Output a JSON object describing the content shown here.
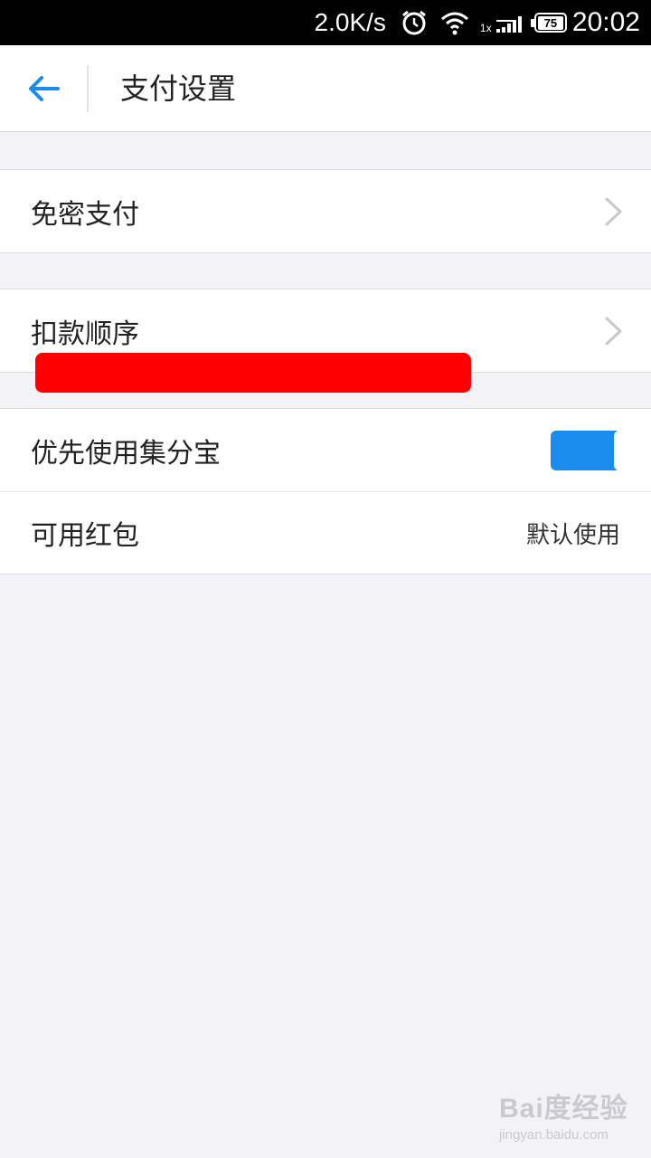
{
  "status_bar": {
    "net_speed": "2.0K/s",
    "signal_label": "1x",
    "battery": "75",
    "time": "20:02",
    "icons": [
      "alarm-icon",
      "wifi-icon",
      "signal-icon",
      "battery-icon"
    ]
  },
  "nav": {
    "back_icon": "arrow-left-icon",
    "title": "支付设置"
  },
  "settings": {
    "free_pay": {
      "label": "免密支付"
    },
    "deduct_order": {
      "label": "扣款顺序"
    },
    "prefer_jifenbao": {
      "label": "优先使用集分宝",
      "enabled": true
    },
    "red_packet": {
      "label": "可用红包",
      "value": "默认使用"
    }
  },
  "colors": {
    "accent": "#1a8cf0",
    "background": "#f2f2f7",
    "redaction": "#ff0000"
  },
  "watermark": {
    "logo": "Bai度经验",
    "url": "jingyan.baidu.com"
  }
}
